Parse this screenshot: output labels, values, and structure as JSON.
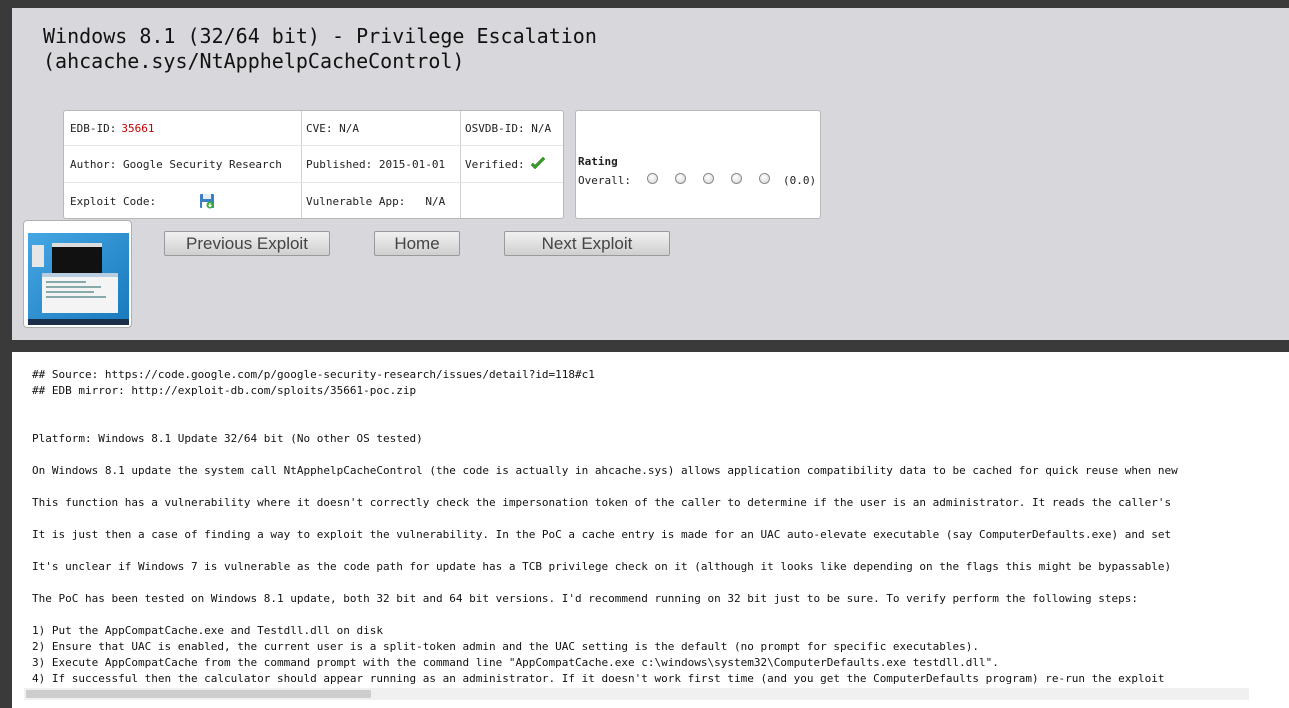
{
  "title": {
    "line1": "Windows 8.1 (32/64 bit) - Privilege Escalation",
    "line2": "(ahcache.sys/NtApphelpCacheControl)"
  },
  "info": {
    "edb_label": "EDB-ID:",
    "edb_id": "35661",
    "cve": "CVE: N/A",
    "osvdb": "OSVDB-ID: N/A",
    "author": "Author: Google Security Research",
    "published": "Published: 2015-01-01",
    "verified_label": "Verified:",
    "exploit_code_label": "Exploit Code:",
    "vulnerable_app_label": "Vulnerable App:",
    "vulnerable_app_value": "N/A"
  },
  "rating": {
    "title": "Rating",
    "overall_label": "Overall:",
    "value": "(0.0)",
    "stars": 5
  },
  "nav": {
    "previous": "Previous Exploit",
    "home": "Home",
    "next": "Next Exploit"
  },
  "code_lines": [
    "## Source: https://code.google.com/p/google-security-research/issues/detail?id=118#c1",
    "## EDB mirror: http://exploit-db.com/sploits/35661-poc.zip",
    "",
    "",
    "Platform: Windows 8.1 Update 32/64 bit (No other OS tested)",
    "",
    "On Windows 8.1 update the system call NtApphelpCacheControl (the code is actually in ahcache.sys) allows application compatibility data to be cached for quick reuse when new",
    "",
    "This function has a vulnerability where it doesn't correctly check the impersonation token of the caller to determine if the user is an administrator. It reads the caller's",
    "",
    "It is just then a case of finding a way to exploit the vulnerability. In the PoC a cache entry is made for an UAC auto-elevate executable (say ComputerDefaults.exe) and set",
    "",
    "It's unclear if Windows 7 is vulnerable as the code path for update has a TCB privilege check on it (although it looks like depending on the flags this might be bypassable)",
    "",
    "The PoC has been tested on Windows 8.1 update, both 32 bit and 64 bit versions. I'd recommend running on 32 bit just to be sure. To verify perform the following steps:",
    "",
    "1) Put the AppCompatCache.exe and Testdll.dll on disk",
    "2) Ensure that UAC is enabled, the current user is a split-token admin and the UAC setting is the default (no prompt for specific executables).",
    "3) Execute AppCompatCache from the command prompt with the command line \"AppCompatCache.exe c:\\windows\\system32\\ComputerDefaults.exe testdll.dll\".",
    "4) If successful then the calculator should appear running as an administrator. If it doesn't work first time (and you get the ComputerDefaults program) re-run the exploit"
  ]
}
